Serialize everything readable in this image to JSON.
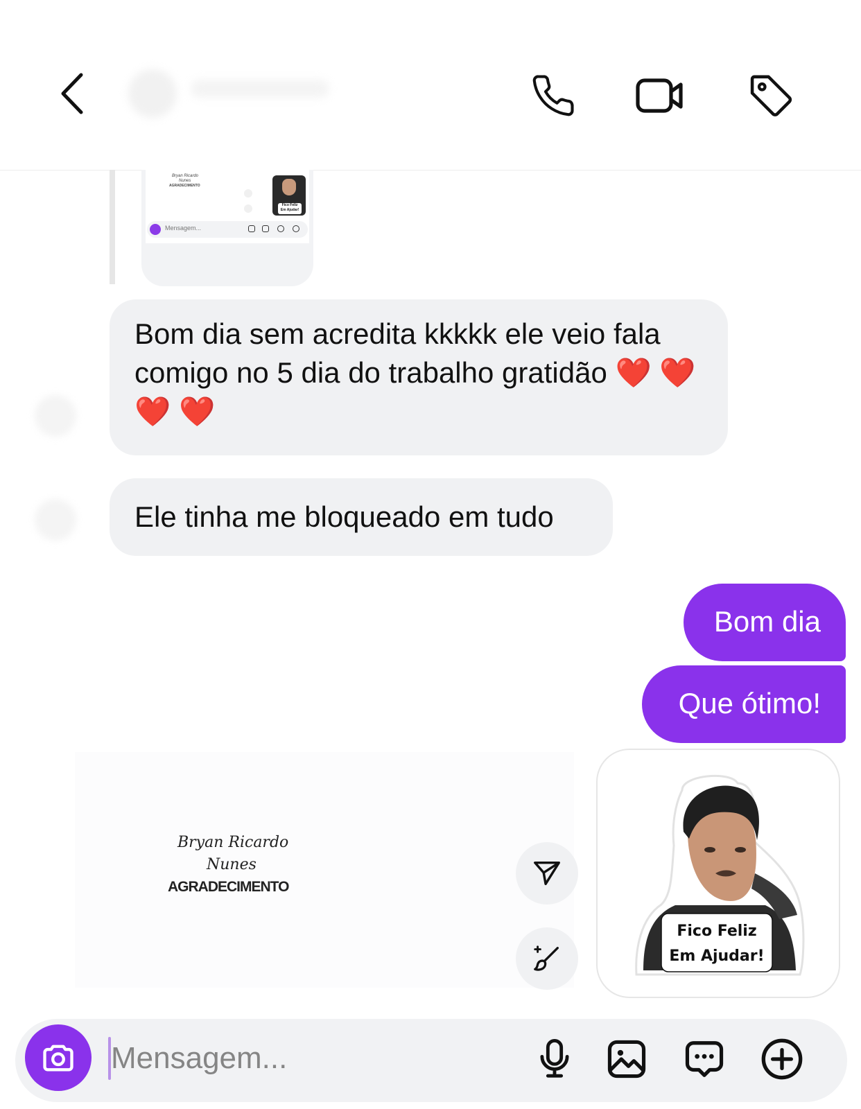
{
  "header": {
    "back_icon": "chevron-left-icon",
    "actions": [
      "phone-icon",
      "video-camera-icon",
      "tag-icon"
    ]
  },
  "quoted_screenshot": {
    "signature_line1": "Bryan Ricardo",
    "signature_line2": "Nunes",
    "caption": "AGRADECIMENTO",
    "sticker_line1": "Fico Feliz",
    "sticker_line2": "Em Ajudar!",
    "input_placeholder": "Mensagem..."
  },
  "messages": [
    {
      "direction": "incoming",
      "text": "Bom dia sem acredita kkkkk ele veio fala comigo no 5 dia do trabalho gratidão ❤️ ❤️ ❤️ ❤️"
    },
    {
      "direction": "incoming",
      "text": "Ele tinha me bloqueado em tudo"
    },
    {
      "direction": "outgoing",
      "text": "Bom dia"
    },
    {
      "direction": "outgoing",
      "text": "Que ótimo!"
    }
  ],
  "sticker": {
    "line1": "Fico Feliz",
    "line2": "Em Ajudar!"
  },
  "preview": {
    "signature_line1": "Bryan Ricardo",
    "signature_line2": "Nunes",
    "caption": "AGRADECIMENTO",
    "side_buttons": [
      "send-outline-icon",
      "magic-brush-icon"
    ]
  },
  "composer": {
    "placeholder": "Mensagem...",
    "icons": [
      "camera-icon",
      "microphone-icon",
      "gallery-icon",
      "sticker-chat-icon",
      "plus-circle-icon"
    ]
  },
  "colors": {
    "accent": "#8a32eb",
    "bubble_incoming": "#f0f1f3",
    "input_bar": "#f1f2f4"
  }
}
